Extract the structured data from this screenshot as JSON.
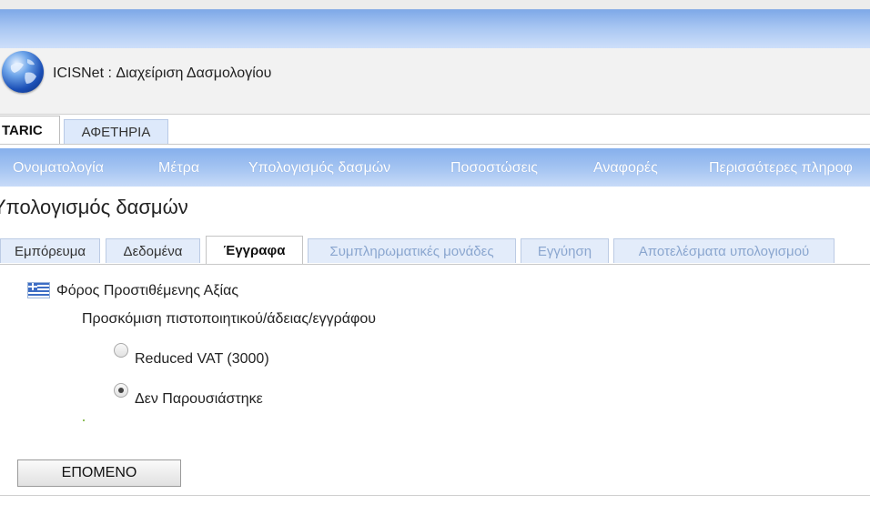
{
  "app": {
    "title": "ICISNet : Διαχείριση Δασμολογίου"
  },
  "top_tabs": [
    {
      "label": "TARIC",
      "active": true
    },
    {
      "label": "ΑΦΕΤΗΡΙΑ",
      "active": false
    }
  ],
  "nav": {
    "items": [
      "Ονοματολογία",
      "Μέτρα",
      "Υπολογισμός δασμών",
      "Ποσοστώσεις",
      "Αναφορές",
      "Περισσότερες πληροφ"
    ]
  },
  "page": {
    "title": "Υπολογισμός δασμών"
  },
  "sub_tabs": [
    {
      "label": "Εμπόρευμα",
      "state": "normal"
    },
    {
      "label": "Δεδομένα",
      "state": "normal"
    },
    {
      "label": "Έγγραφα",
      "state": "active"
    },
    {
      "label": "Συμπληρωματικές μονάδες",
      "state": "disabled"
    },
    {
      "label": "Εγγύηση",
      "state": "disabled"
    },
    {
      "label": "Αποτελέσματα υπολογισμού",
      "state": "disabled"
    }
  ],
  "form": {
    "section_label": "Φόρος Προστιθέμενης Αξίας",
    "flag_icon": "greek-flag-icon",
    "question": "Προσκόμιση πιστοποιητικού/άδειας/εγγράφου",
    "options": [
      {
        "label": "Reduced VAT (3000)",
        "checked": false
      },
      {
        "label": "Δεν Παρουσιάστηκε",
        "checked": true
      }
    ],
    "next_button": "ΕΠΟΜΕΝΟ"
  },
  "colors": {
    "nav_bar": "#a6c5f2",
    "header_band": "#a8c6f2",
    "tab_inactive": "#e3ecfa",
    "tab_disabled_text": "#8aa6cf"
  }
}
